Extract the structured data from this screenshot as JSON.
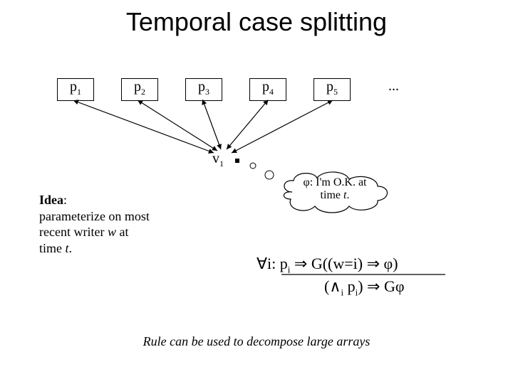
{
  "title": "Temporal case splitting",
  "boxes": {
    "p1": "p",
    "p1_sub": "1",
    "p2": "p",
    "p2_sub": "2",
    "p3": "p",
    "p3_sub": "3",
    "p4": "p",
    "p4_sub": "4",
    "p5": "p",
    "p5_sub": "5"
  },
  "ellipsis": "...",
  "v_label": "v",
  "v_sub": "1",
  "idea_bold": "Idea",
  "idea_text_l1": ":",
  "idea_text_l2": "parameterize on most",
  "idea_text_l3": "recent writer ",
  "idea_w": "w",
  "idea_text_l3b": " at",
  "idea_text_l4": "time ",
  "idea_t": "t",
  "idea_text_l4b": ".",
  "cloud_l1a": "φ: I'm O.K. at",
  "cloud_l2a": "time ",
  "cloud_t": "t",
  "cloud_l2b": ".",
  "formula1_a": "∀i: p",
  "formula1_sub": "i",
  "formula1_b": " ⇒ G((w=i) ⇒ φ)",
  "formula2_a": "(∧",
  "formula2_sub1": "i",
  "formula2_b": " p",
  "formula2_sub2": "i",
  "formula2_c": ") ⇒ Gφ",
  "footnote": "Rule can be used to decompose large arrays"
}
